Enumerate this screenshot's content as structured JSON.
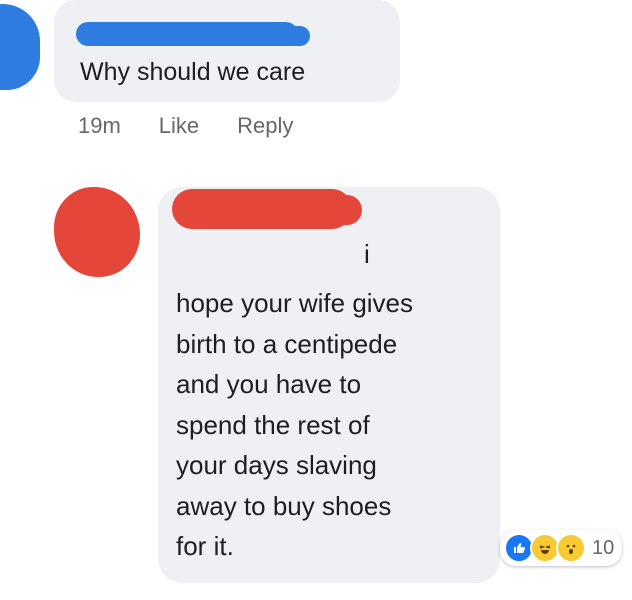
{
  "comment_1": {
    "text": "Why should we care",
    "meta": {
      "time": "19m",
      "like_label": "Like",
      "reply_label": "Reply"
    }
  },
  "comment_2": {
    "name_fragment": "i",
    "lines": [
      "hope your wife gives",
      "birth to a centipede",
      "and you have to",
      "spend the rest of",
      "your days slaving",
      "away to buy shoes",
      "for it."
    ],
    "reactions": {
      "icons": [
        "like-icon",
        "haha-icon",
        "wow-icon"
      ],
      "count": "10"
    }
  },
  "colors": {
    "redaction_blue": "#2f7de1",
    "redaction_red": "#e5463a",
    "bubble_bg": "#eef0f3",
    "meta_gray": "#65676b",
    "like_blue": "#1877f2"
  }
}
